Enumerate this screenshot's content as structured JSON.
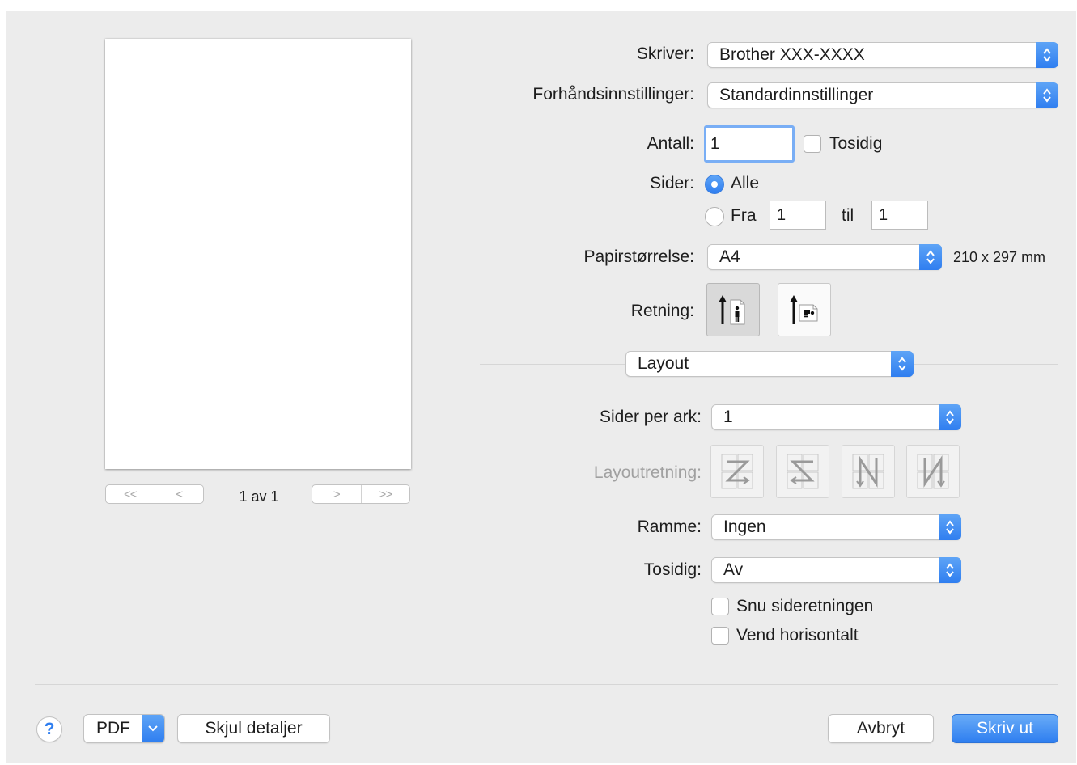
{
  "preview": {
    "first_page": "<<",
    "prev_page": "<",
    "next_page": ">",
    "last_page": ">>",
    "page_count": "1 av 1"
  },
  "printer": {
    "label": "Skriver:",
    "value": "Brother XXX-XXXX"
  },
  "presets": {
    "label": "Forhåndsinnstillinger:",
    "value": "Standardinnstillinger"
  },
  "copies": {
    "label": "Antall:",
    "value": "1",
    "duplex_label": "Tosidig",
    "duplex_checked": false
  },
  "pages": {
    "label": "Sider:",
    "all_label": "Alle",
    "all_selected": true,
    "from_label": "Fra",
    "from_value": "1",
    "to_label": "til",
    "to_value": "1"
  },
  "paper_size": {
    "label": "Papirstørrelse:",
    "value": "A4",
    "dimensions": "210 x 297 mm"
  },
  "orientation": {
    "label": "Retning:",
    "selected": "portrait",
    "portrait_icon": "portrait-orientation-icon",
    "landscape_icon": "landscape-orientation-icon"
  },
  "panel": {
    "value": "Layout"
  },
  "layout": {
    "pages_per_sheet_label": "Sider per ark:",
    "pages_per_sheet_value": "1",
    "direction_label": "Layoutretning:",
    "direction_icons": [
      "z-layout-icon",
      "reverse-z-layout-icon",
      "n-reverse-layout-icon",
      "n-layout-icon"
    ],
    "border_label": "Ramme:",
    "border_value": "Ingen",
    "duplex_label": "Tosidig:",
    "duplex_value": "Av",
    "reverse_orientation_label": "Snu sideretningen",
    "reverse_orientation_checked": false,
    "flip_horizontal_label": "Vend horisontalt",
    "flip_horizontal_checked": false
  },
  "footer": {
    "help_label": "?",
    "pdf_label": "PDF",
    "hide_details_label": "Skjul detaljer",
    "cancel_label": "Avbryt",
    "print_label": "Skriv ut"
  },
  "colors": {
    "accent": "#2f7ef0",
    "dialog_bg": "#ececec",
    "focus_ring": "#79aef5"
  }
}
